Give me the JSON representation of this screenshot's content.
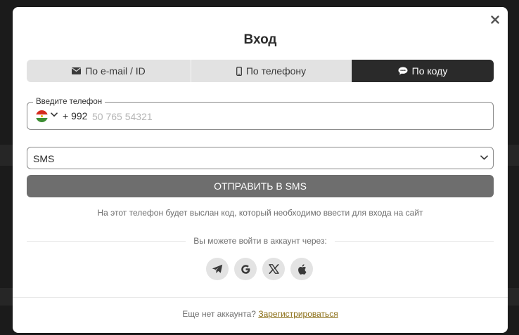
{
  "colors": {
    "backdrop": "#1b1b1b",
    "modal_bg": "#ffffff",
    "tab_active_bg": "#2a2a2a",
    "tab_inactive_bg": "#e2e2e2",
    "send_button_bg": "#6e6e6e",
    "register_link": "#8a6d14"
  },
  "modal": {
    "title": "Вход",
    "close_icon": "close-icon"
  },
  "tabs": [
    {
      "label": "По e-mail / ID",
      "icon": "envelope-icon",
      "active": false
    },
    {
      "label": "По телефону",
      "icon": "mobile-phone-icon",
      "active": false
    },
    {
      "label": "По коду",
      "icon": "chat-bubble-icon",
      "active": true
    }
  ],
  "phone": {
    "label": "Введите телефон",
    "country_flag": "tajikistan-flag-icon",
    "dial_code": "+ 992",
    "value": "",
    "placeholder": "50 765 54321"
  },
  "delivery_method": {
    "selected": "SMS"
  },
  "send_button": {
    "label": "ОТПРАВИТЬ В SMS"
  },
  "hint_text": "На этот телефон будет выслан код, который необходимо ввести для входа на сайт",
  "social_login": {
    "caption": "Вы можете войти в аккаунт через:",
    "providers": [
      {
        "icon": "telegram-icon"
      },
      {
        "icon": "google-icon"
      },
      {
        "icon": "x-icon"
      },
      {
        "icon": "apple-icon"
      }
    ]
  },
  "footer": {
    "text": "Еще нет аккаунта?",
    "register_link": "Зарегистрироваться"
  }
}
